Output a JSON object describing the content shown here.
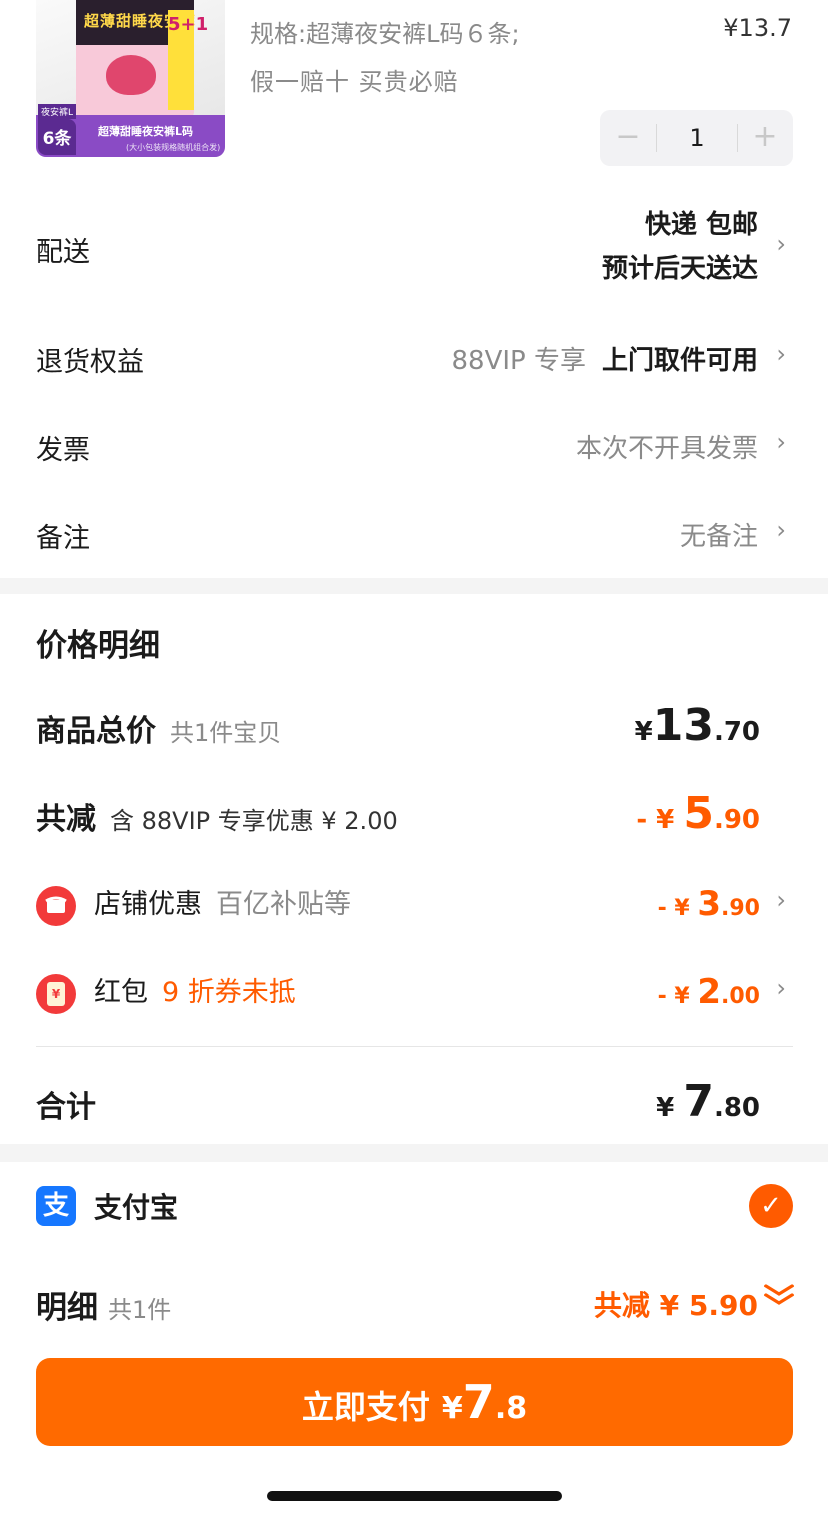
{
  "product": {
    "spec": "规格:超薄夜安裤L码６条;",
    "unit_price": "¥13.7",
    "guarantee": "假一赔十  买贵必赔",
    "quantity": "1",
    "minus_glyph": "−",
    "plus_glyph": "+",
    "image_text": {
      "pack_title": "超薄甜睡夜安裤",
      "plus_badge": "5+1",
      "band_text": "超薄甜睡夜安裤L码",
      "band_sub": "(大小包装规格随机组合发)",
      "six_top": "夜安裤L",
      "six": "6条"
    }
  },
  "rows": {
    "delivery": {
      "label": "配送",
      "line1": "快递 包邮",
      "line2": "预计后天送达"
    },
    "returns": {
      "label": "退货权益",
      "tag": "88VIP 专享",
      "value": "上门取件可用"
    },
    "invoice": {
      "label": "发票",
      "value": "本次不开具发票"
    },
    "note": {
      "label": "备注",
      "value": "无备注"
    }
  },
  "chevron": "›",
  "price": {
    "title": "价格明细",
    "total": {
      "label": "商品总价",
      "sub": "共1件宝贝",
      "sym": "¥",
      "int": "13",
      "dec": ".70"
    },
    "reduce": {
      "label": "共减",
      "sub": "含 88VIP 专享优惠 ¥ 2.00",
      "sym": "- ¥ ",
      "int": "5",
      "dec": ".90"
    },
    "shop": {
      "label": "店铺优惠",
      "sub": "百亿补贴等",
      "sym": "- ¥ ",
      "int": "3",
      "dec": ".90"
    },
    "redpacket": {
      "label": "红包",
      "sub": "9 折券未抵",
      "icon_glyph": "¥",
      "sym": "- ¥ ",
      "int": "2",
      "dec": ".00"
    },
    "sum": {
      "label": "合计",
      "sym": "¥ ",
      "int": "7",
      "dec": ".80"
    }
  },
  "pay": {
    "method": "支付宝",
    "method_icon": "支",
    "check": "✓",
    "detail_label": "明细",
    "detail_sub": "共1件",
    "detail_reduce": "共减 ¥ 5.90",
    "chev_down": "⌄",
    "button": {
      "label": "立即支付",
      "sym": "¥",
      "int": "7",
      "dec": ".8"
    }
  },
  "colors": {
    "accent": "#ff5b00",
    "button": "#ff6a00",
    "alipay": "#1677ff"
  },
  "icons": {
    "shop_discount": "store-icon",
    "red_packet": "red-packet-icon",
    "alipay": "alipay-icon",
    "selected": "check-icon"
  }
}
